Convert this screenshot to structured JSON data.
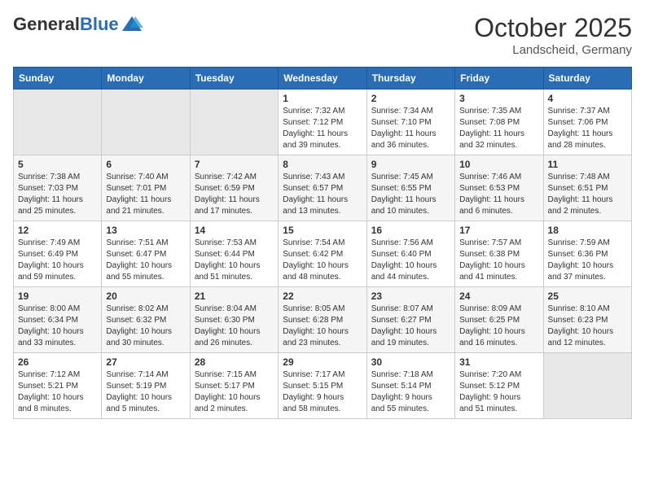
{
  "header": {
    "logo_general": "General",
    "logo_blue": "Blue",
    "month_title": "October 2025",
    "location": "Landscheid, Germany"
  },
  "weekdays": [
    "Sunday",
    "Monday",
    "Tuesday",
    "Wednesday",
    "Thursday",
    "Friday",
    "Saturday"
  ],
  "weeks": [
    [
      {
        "day": "",
        "info": ""
      },
      {
        "day": "",
        "info": ""
      },
      {
        "day": "",
        "info": ""
      },
      {
        "day": "1",
        "info": "Sunrise: 7:32 AM\nSunset: 7:12 PM\nDaylight: 11 hours\nand 39 minutes."
      },
      {
        "day": "2",
        "info": "Sunrise: 7:34 AM\nSunset: 7:10 PM\nDaylight: 11 hours\nand 36 minutes."
      },
      {
        "day": "3",
        "info": "Sunrise: 7:35 AM\nSunset: 7:08 PM\nDaylight: 11 hours\nand 32 minutes."
      },
      {
        "day": "4",
        "info": "Sunrise: 7:37 AM\nSunset: 7:06 PM\nDaylight: 11 hours\nand 28 minutes."
      }
    ],
    [
      {
        "day": "5",
        "info": "Sunrise: 7:38 AM\nSunset: 7:03 PM\nDaylight: 11 hours\nand 25 minutes."
      },
      {
        "day": "6",
        "info": "Sunrise: 7:40 AM\nSunset: 7:01 PM\nDaylight: 11 hours\nand 21 minutes."
      },
      {
        "day": "7",
        "info": "Sunrise: 7:42 AM\nSunset: 6:59 PM\nDaylight: 11 hours\nand 17 minutes."
      },
      {
        "day": "8",
        "info": "Sunrise: 7:43 AM\nSunset: 6:57 PM\nDaylight: 11 hours\nand 13 minutes."
      },
      {
        "day": "9",
        "info": "Sunrise: 7:45 AM\nSunset: 6:55 PM\nDaylight: 11 hours\nand 10 minutes."
      },
      {
        "day": "10",
        "info": "Sunrise: 7:46 AM\nSunset: 6:53 PM\nDaylight: 11 hours\nand 6 minutes."
      },
      {
        "day": "11",
        "info": "Sunrise: 7:48 AM\nSunset: 6:51 PM\nDaylight: 11 hours\nand 2 minutes."
      }
    ],
    [
      {
        "day": "12",
        "info": "Sunrise: 7:49 AM\nSunset: 6:49 PM\nDaylight: 10 hours\nand 59 minutes."
      },
      {
        "day": "13",
        "info": "Sunrise: 7:51 AM\nSunset: 6:47 PM\nDaylight: 10 hours\nand 55 minutes."
      },
      {
        "day": "14",
        "info": "Sunrise: 7:53 AM\nSunset: 6:44 PM\nDaylight: 10 hours\nand 51 minutes."
      },
      {
        "day": "15",
        "info": "Sunrise: 7:54 AM\nSunset: 6:42 PM\nDaylight: 10 hours\nand 48 minutes."
      },
      {
        "day": "16",
        "info": "Sunrise: 7:56 AM\nSunset: 6:40 PM\nDaylight: 10 hours\nand 44 minutes."
      },
      {
        "day": "17",
        "info": "Sunrise: 7:57 AM\nSunset: 6:38 PM\nDaylight: 10 hours\nand 41 minutes."
      },
      {
        "day": "18",
        "info": "Sunrise: 7:59 AM\nSunset: 6:36 PM\nDaylight: 10 hours\nand 37 minutes."
      }
    ],
    [
      {
        "day": "19",
        "info": "Sunrise: 8:00 AM\nSunset: 6:34 PM\nDaylight: 10 hours\nand 33 minutes."
      },
      {
        "day": "20",
        "info": "Sunrise: 8:02 AM\nSunset: 6:32 PM\nDaylight: 10 hours\nand 30 minutes."
      },
      {
        "day": "21",
        "info": "Sunrise: 8:04 AM\nSunset: 6:30 PM\nDaylight: 10 hours\nand 26 minutes."
      },
      {
        "day": "22",
        "info": "Sunrise: 8:05 AM\nSunset: 6:28 PM\nDaylight: 10 hours\nand 23 minutes."
      },
      {
        "day": "23",
        "info": "Sunrise: 8:07 AM\nSunset: 6:27 PM\nDaylight: 10 hours\nand 19 minutes."
      },
      {
        "day": "24",
        "info": "Sunrise: 8:09 AM\nSunset: 6:25 PM\nDaylight: 10 hours\nand 16 minutes."
      },
      {
        "day": "25",
        "info": "Sunrise: 8:10 AM\nSunset: 6:23 PM\nDaylight: 10 hours\nand 12 minutes."
      }
    ],
    [
      {
        "day": "26",
        "info": "Sunrise: 7:12 AM\nSunset: 5:21 PM\nDaylight: 10 hours\nand 8 minutes."
      },
      {
        "day": "27",
        "info": "Sunrise: 7:14 AM\nSunset: 5:19 PM\nDaylight: 10 hours\nand 5 minutes."
      },
      {
        "day": "28",
        "info": "Sunrise: 7:15 AM\nSunset: 5:17 PM\nDaylight: 10 hours\nand 2 minutes."
      },
      {
        "day": "29",
        "info": "Sunrise: 7:17 AM\nSunset: 5:15 PM\nDaylight: 9 hours\nand 58 minutes."
      },
      {
        "day": "30",
        "info": "Sunrise: 7:18 AM\nSunset: 5:14 PM\nDaylight: 9 hours\nand 55 minutes."
      },
      {
        "day": "31",
        "info": "Sunrise: 7:20 AM\nSunset: 5:12 PM\nDaylight: 9 hours\nand 51 minutes."
      },
      {
        "day": "",
        "info": ""
      }
    ]
  ]
}
